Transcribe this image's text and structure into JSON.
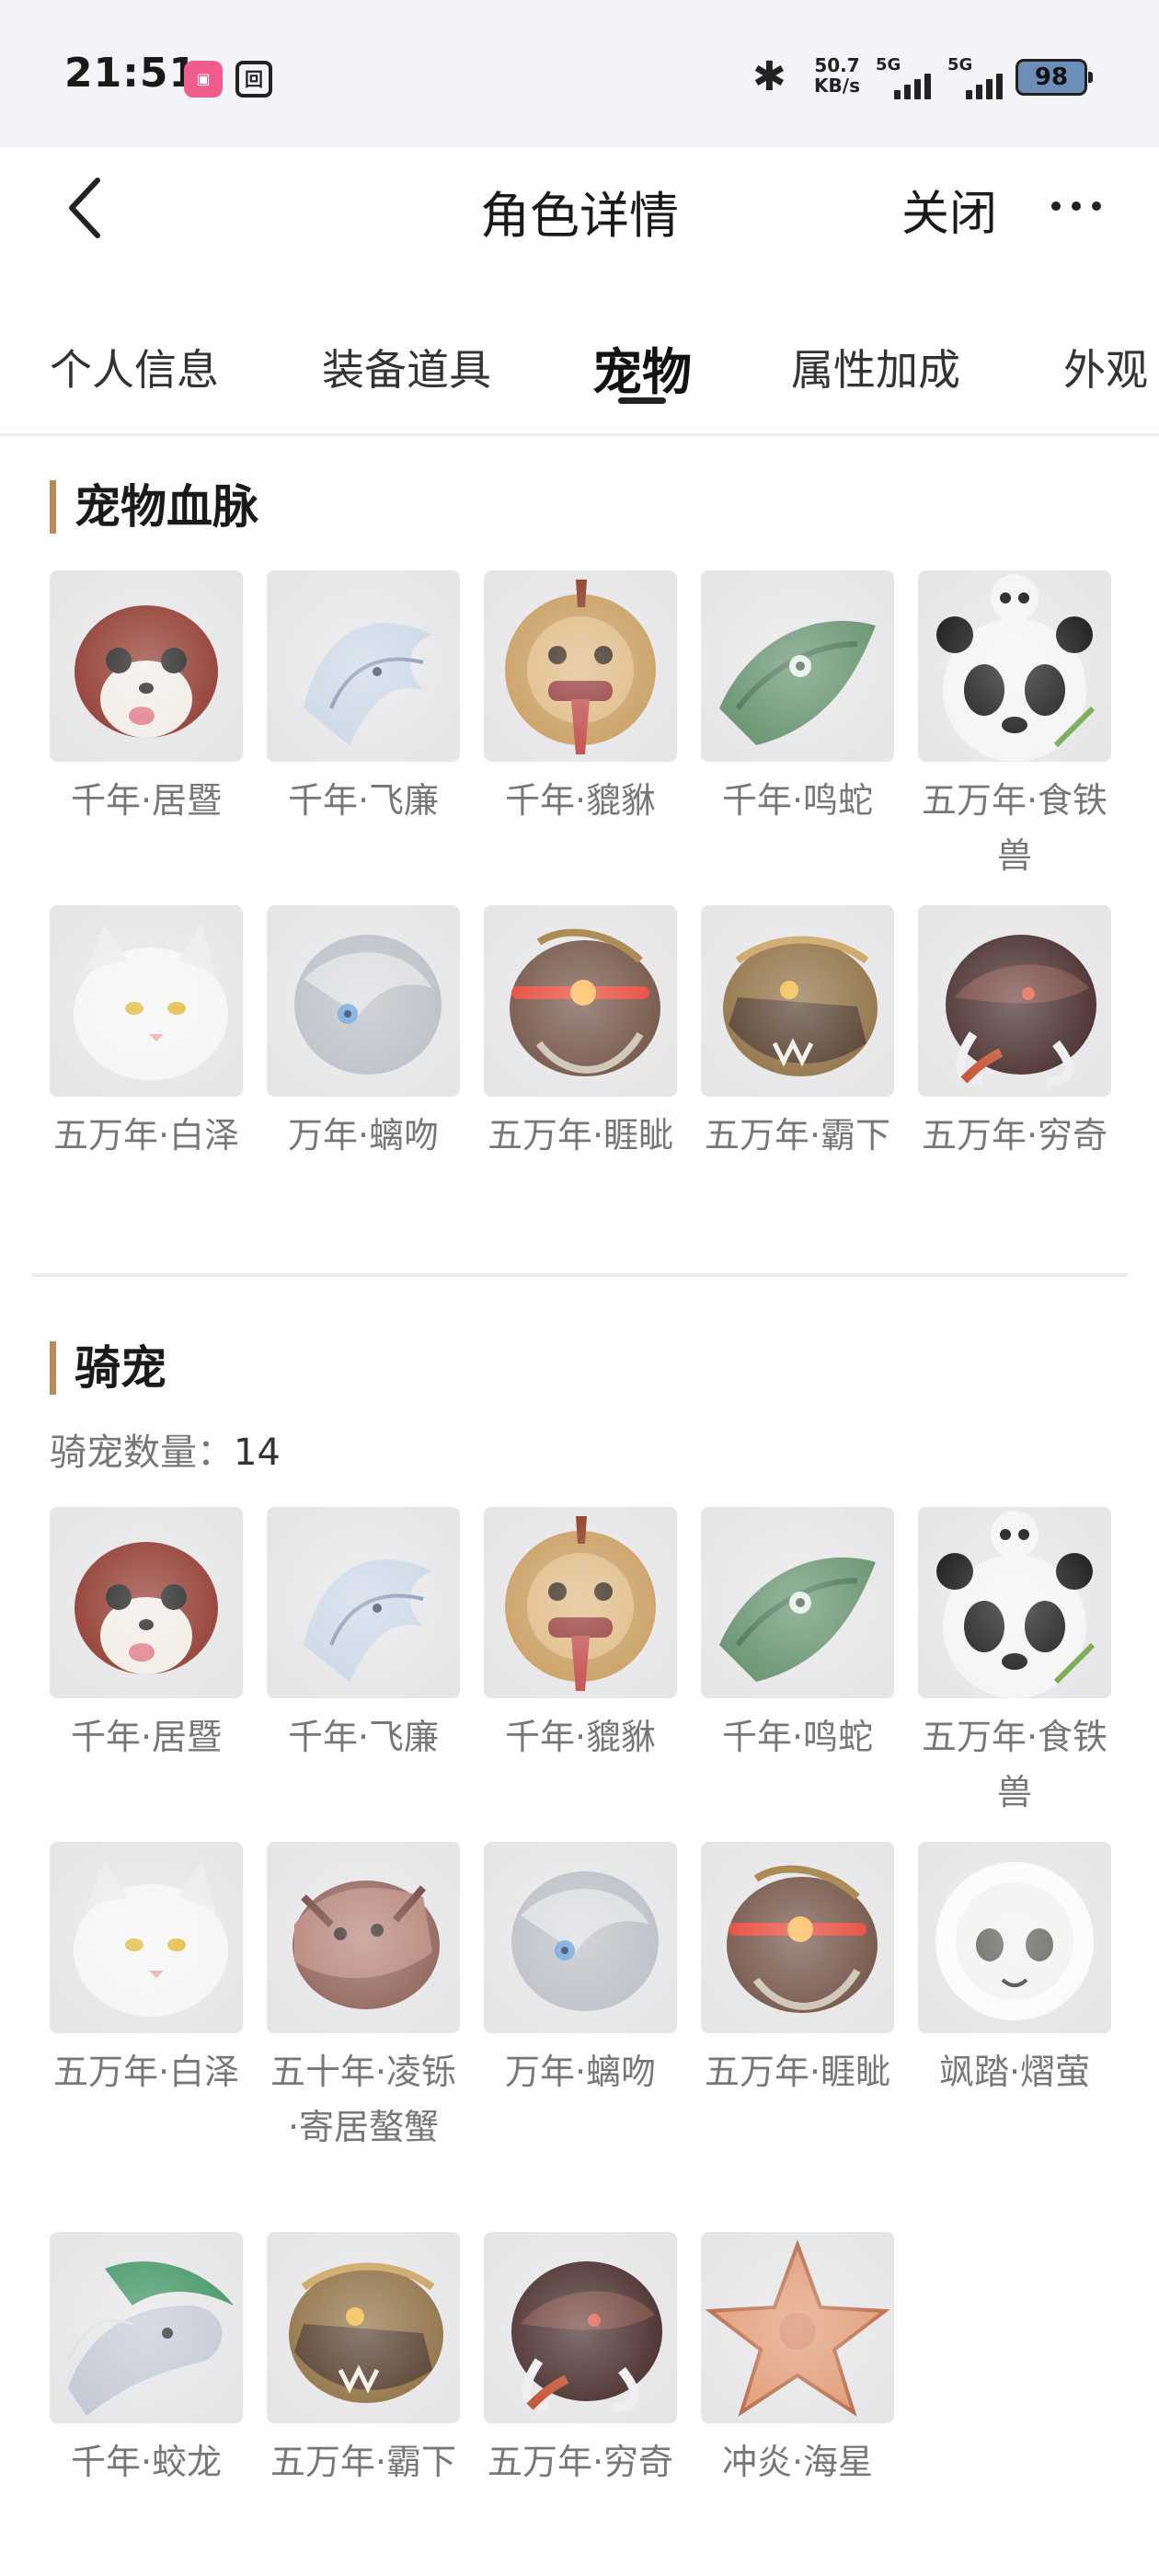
{
  "status_bar": {
    "time": "21:51",
    "app_badge_1": "bilibili",
    "app_badge_2": "回",
    "network_speed": "50.7",
    "network_speed_unit": "KB/s",
    "signal_1": "5G",
    "signal_2": "5G",
    "battery": "98"
  },
  "header": {
    "title": "角色详情",
    "close_label": "关闭"
  },
  "tabs": [
    {
      "label": "个人信息"
    },
    {
      "label": "装备道具"
    },
    {
      "label": "宠物"
    },
    {
      "label": "属性加成"
    },
    {
      "label": "外观"
    }
  ],
  "bloodline": {
    "title": "宠物血脉",
    "items": [
      {
        "name": "千年·居暨",
        "icon": "squirrel-icon"
      },
      {
        "name": "千年·飞廉",
        "icon": "white-bird-icon"
      },
      {
        "name": "千年·貔貅",
        "icon": "lion-beast-icon"
      },
      {
        "name": "千年·鸣蛇",
        "icon": "green-serpent-icon"
      },
      {
        "name": "五万年·食铁兽",
        "icon": "panda-icon"
      },
      {
        "name": "五万年·白泽",
        "icon": "white-cat-icon"
      },
      {
        "name": "万年·螭吻",
        "icon": "silver-dragon-icon"
      },
      {
        "name": "五万年·睚眦",
        "icon": "red-dragon-icon"
      },
      {
        "name": "五万年·霸下",
        "icon": "gold-dragon-icon"
      },
      {
        "name": "五万年·穷奇",
        "icon": "dark-tusk-beast-icon"
      }
    ]
  },
  "mounts": {
    "title": "骑宠",
    "count_label": "骑宠数量：",
    "count": "14",
    "items": [
      {
        "name": "千年·居暨",
        "icon": "squirrel-icon"
      },
      {
        "name": "千年·飞廉",
        "icon": "white-bird-icon"
      },
      {
        "name": "千年·貔貅",
        "icon": "lion-beast-icon"
      },
      {
        "name": "千年·鸣蛇",
        "icon": "green-serpent-icon"
      },
      {
        "name": "五万年·食铁兽",
        "icon": "panda-icon"
      },
      {
        "name": "五万年·白泽",
        "icon": "white-cat-icon"
      },
      {
        "name": "五十年·凌铄·寄居螯蟹",
        "icon": "hermit-crab-icon"
      },
      {
        "name": "万年·螭吻",
        "icon": "silver-dragon-icon"
      },
      {
        "name": "五万年·睚眦",
        "icon": "red-dragon-icon"
      },
      {
        "name": "飒踏·熠萤",
        "icon": "white-puff-icon"
      },
      {
        "name": "千年·蛟龙",
        "icon": "jiao-dragon-icon"
      },
      {
        "name": "五万年·霸下",
        "icon": "gold-dragon-icon"
      },
      {
        "name": "五万年·穷奇",
        "icon": "dark-tusk-beast-icon"
      },
      {
        "name": "冲炎·海星",
        "icon": "starfish-icon"
      }
    ]
  }
}
